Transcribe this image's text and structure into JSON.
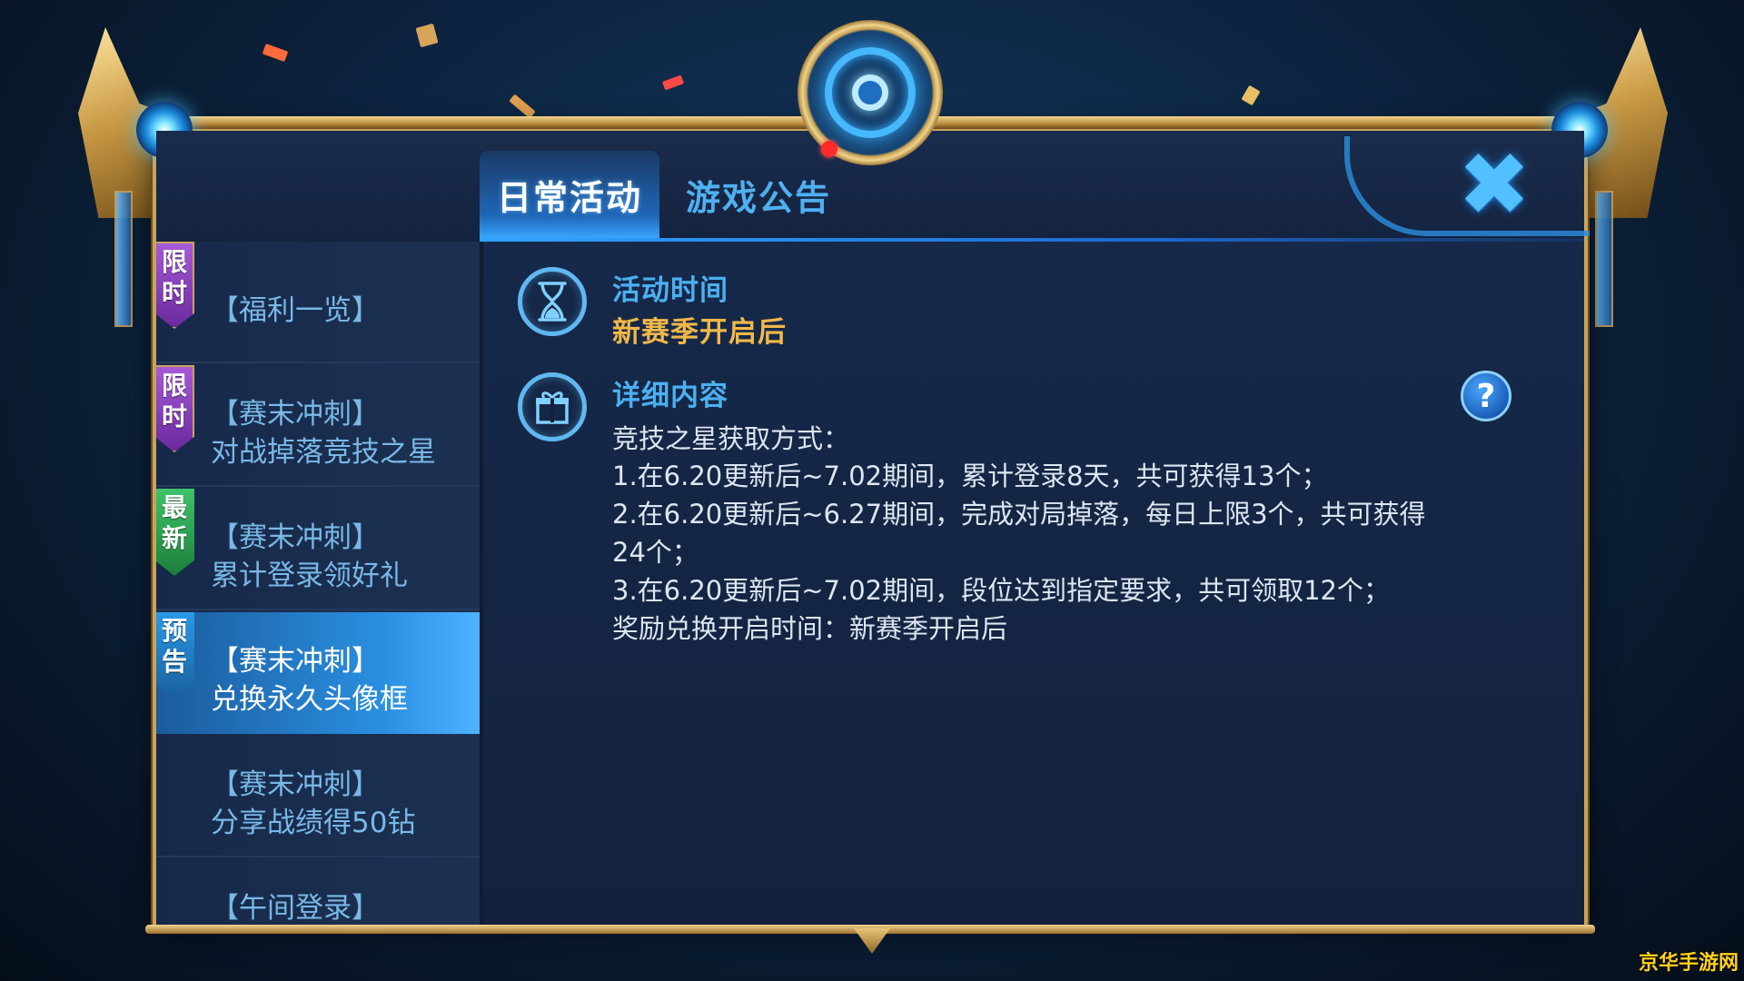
{
  "tabs": [
    {
      "label": "日常活动",
      "active": true
    },
    {
      "label": "游戏公告",
      "active": false
    }
  ],
  "sidebar": {
    "items": [
      {
        "badge": [
          "限",
          "时"
        ],
        "badge_color": "purple",
        "line1": "【福利一览】",
        "line2": ""
      },
      {
        "badge": [
          "限",
          "时"
        ],
        "badge_color": "purple",
        "line1": "【赛末冲刺】",
        "line2": "对战掉落竞技之星"
      },
      {
        "badge": [
          "最",
          "新"
        ],
        "badge_color": "green",
        "line1": "【赛末冲刺】",
        "line2": "累计登录领好礼"
      },
      {
        "badge": [
          "预",
          "告"
        ],
        "badge_color": "blue",
        "line1": "【赛末冲刺】",
        "line2": "兑换永久头像框",
        "selected": true
      },
      {
        "badge": [],
        "line1": "【赛末冲刺】",
        "line2": "分享战绩得50钻"
      },
      {
        "badge": [],
        "line1": "【午间登录】",
        "line2": ""
      }
    ]
  },
  "content": {
    "time_section": {
      "icon": "hourglass-icon",
      "title": "活动时间",
      "value": "新赛季开启后"
    },
    "detail_section": {
      "icon": "gift-icon",
      "title": "详细内容",
      "lines": [
        "竞技之星获取方式：",
        "1.在6.20更新后~7.02期间，累计登录8天，共可获得13个；",
        "2.在6.20更新后~6.27期间，完成对局掉落，每日上限3个，共可获得",
        "24个；",
        "3.在6.20更新后~7.02期间，段位达到指定要求，共可领取12个；",
        "奖励兑换开启时间：新赛季开启后"
      ]
    },
    "help_label": "?"
  },
  "close_label": "✖",
  "watermark": "京华手游网",
  "colors": {
    "accent_blue": "#4bb0f0",
    "gold": "#f0b84a",
    "frame_gold": "#caa35a",
    "badge_purple": "#a65ad8",
    "badge_green": "#3ec36b",
    "badge_blue": "#2a9ae6"
  }
}
